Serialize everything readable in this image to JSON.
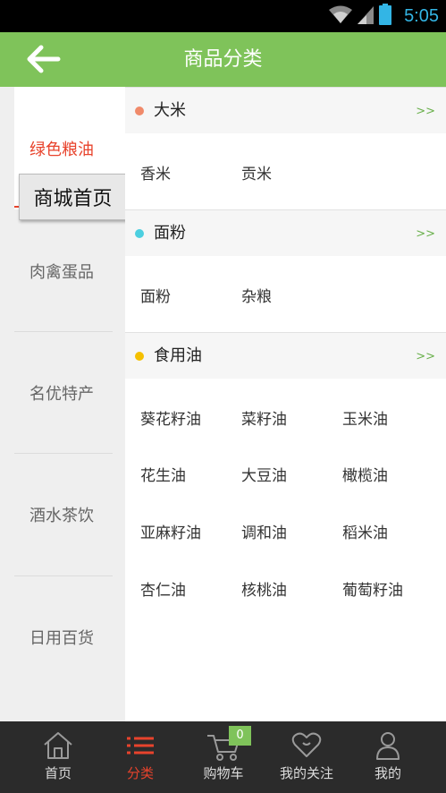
{
  "status_bar": {
    "time": "5:05",
    "icons": [
      "wifi-icon",
      "signal-icon",
      "battery-icon"
    ]
  },
  "app_bar": {
    "title": "商品分类",
    "back_icon": "arrow-left-icon"
  },
  "sidebar": {
    "items": [
      {
        "label": "绿色粮油",
        "active": true
      },
      {
        "label": "肉禽蛋品",
        "active": false
      },
      {
        "label": "名优特产",
        "active": false
      },
      {
        "label": "酒水茶饮",
        "active": false
      },
      {
        "label": "日用百货",
        "active": false
      }
    ]
  },
  "tooltip": {
    "text": "商城首页"
  },
  "categories": [
    {
      "title": "大米",
      "more": ">>",
      "dot_color": "#f08a6a",
      "items": [
        "香米",
        "贡米"
      ]
    },
    {
      "title": "面粉",
      "more": ">>",
      "dot_color": "#4ccfe0",
      "items": [
        "面粉",
        "杂粮"
      ]
    },
    {
      "title": "食用油",
      "more": ">>",
      "dot_color": "#f5c000",
      "items": [
        "葵花籽油",
        "菜籽油",
        "玉米油",
        "花生油",
        "大豆油",
        "橄榄油",
        "亚麻籽油",
        "调和油",
        "稻米油",
        "杏仁油",
        "核桃油",
        "葡萄籽油"
      ]
    }
  ],
  "bottom_nav": {
    "items": [
      {
        "label": "首页",
        "icon": "home-icon",
        "active": false
      },
      {
        "label": "分类",
        "icon": "list-icon",
        "active": true
      },
      {
        "label": "购物车",
        "icon": "cart-icon",
        "active": false
      },
      {
        "label": "我的关注",
        "icon": "heart-icon",
        "active": false
      },
      {
        "label": "我的",
        "icon": "user-icon",
        "active": false
      }
    ],
    "cart_badge": "0"
  },
  "colors": {
    "accent_green": "#7fc35a",
    "active_red": "#e8432c",
    "status_blue": "#33b5e5"
  }
}
